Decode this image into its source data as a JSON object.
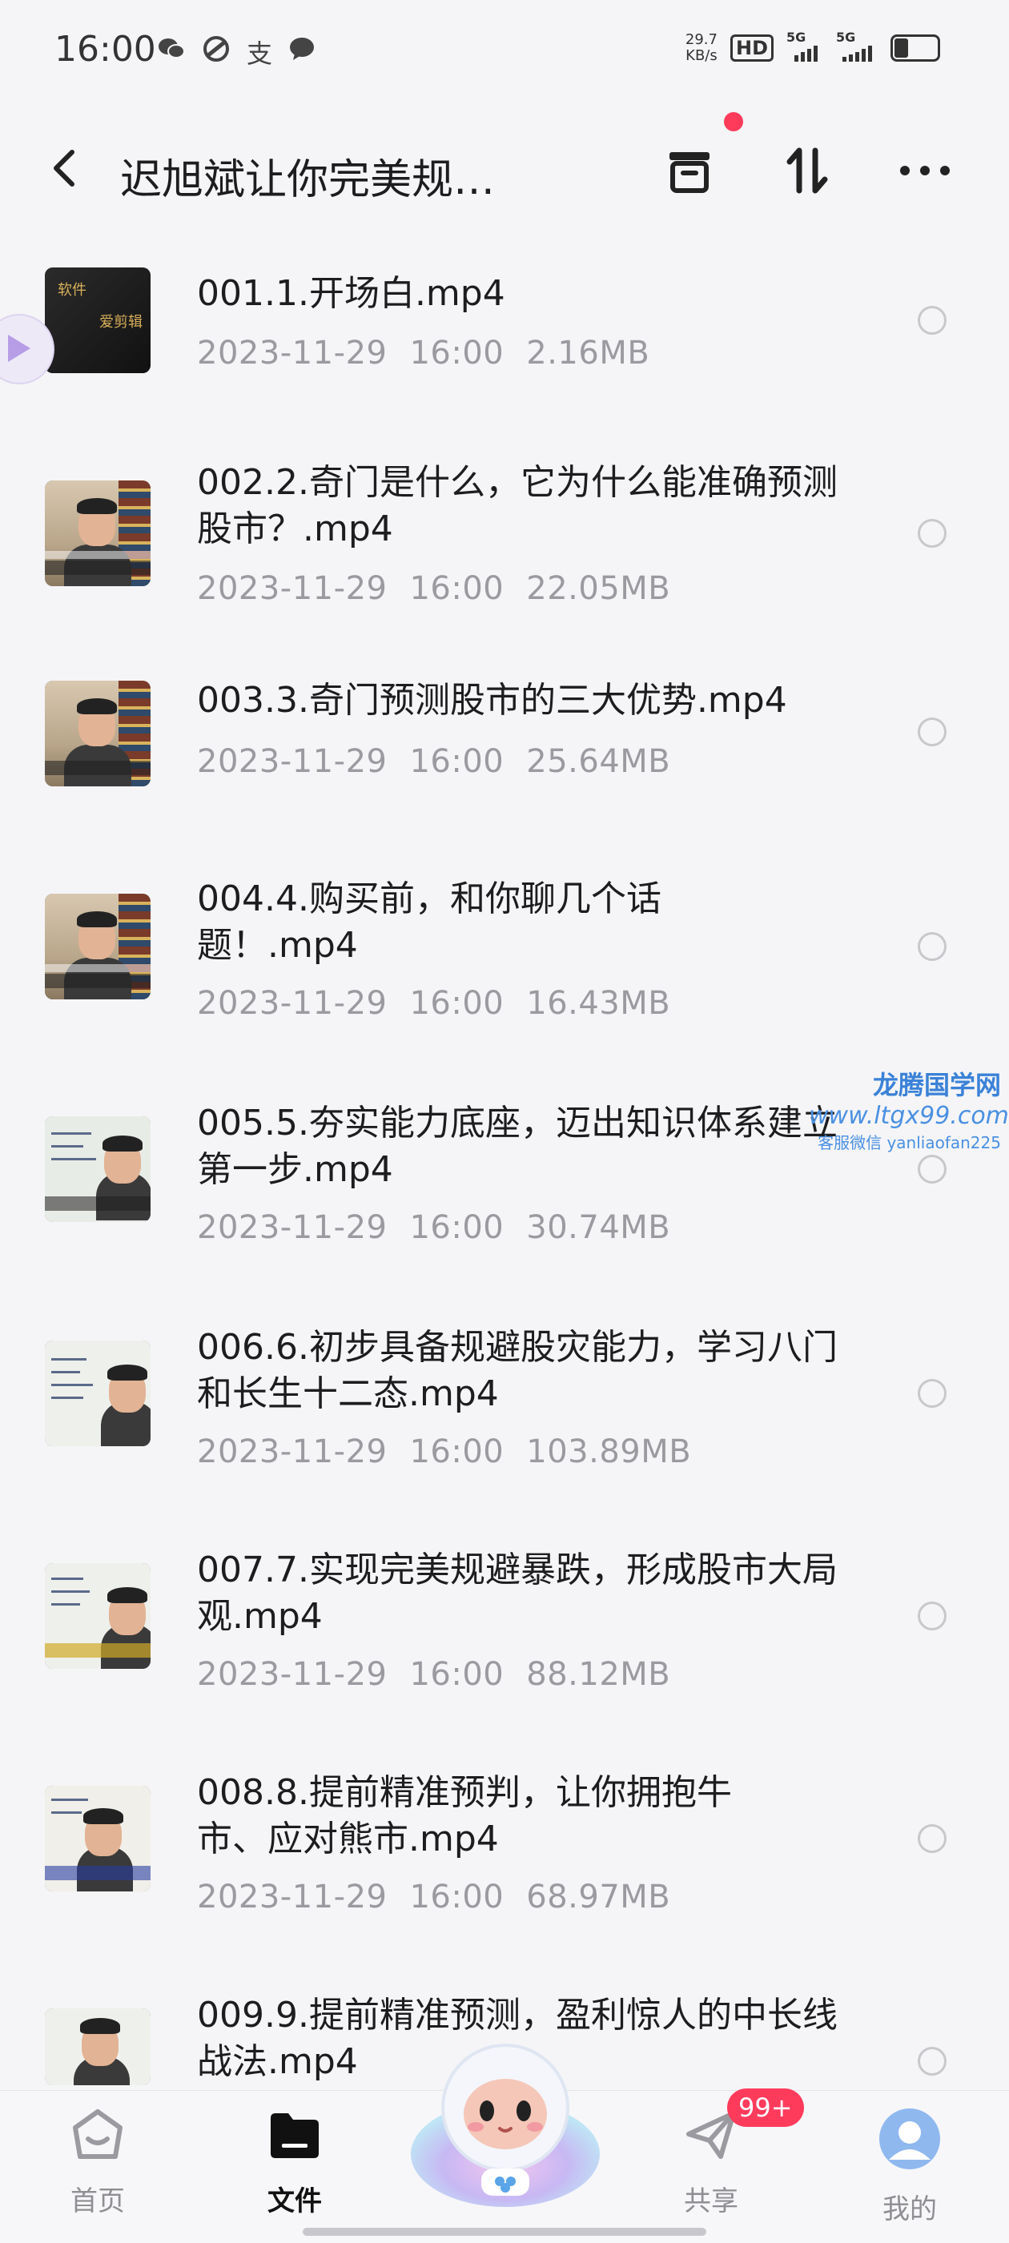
{
  "status_bar": {
    "time": "16:00",
    "notifications": [
      "wechat-icon",
      "link-icon",
      "支",
      "chat-icon"
    ],
    "net_speed": "29.7",
    "net_unit": "KB/s",
    "hd": "HD",
    "sim1": "5G",
    "sim2": "5G",
    "battery_level": 0.3
  },
  "header": {
    "title": "迟旭斌让你完美规…"
  },
  "files": [
    {
      "name": "001.1.开场白.mp4",
      "date": "2023-11-29",
      "time": "16:00",
      "size": "2.16MB",
      "thumb": "software"
    },
    {
      "name": "002.2.奇门是什么，它为什么能准确预测股市？.mp4",
      "date": "2023-11-29",
      "time": "16:00",
      "size": "22.05MB",
      "thumb": "speaker"
    },
    {
      "name": "003.3.奇门预测股市的三大优势.mp4",
      "date": "2023-11-29",
      "time": "16:00",
      "size": "25.64MB",
      "thumb": "speaker"
    },
    {
      "name": "004.4.购买前，和你聊几个话题！.mp4",
      "date": "2023-11-29",
      "time": "16:00",
      "size": "16.43MB",
      "thumb": "speaker"
    },
    {
      "name": "005.5.夯实能力底座，迈出知识体系建立第一步.mp4",
      "date": "2023-11-29",
      "time": "16:00",
      "size": "30.74MB",
      "thumb": "board"
    },
    {
      "name": "006.6.初步具备规避股灾能力，学习八门和长生十二态.mp4",
      "date": "2023-11-29",
      "time": "16:00",
      "size": "103.89MB",
      "thumb": "board"
    },
    {
      "name": "007.7.实现完美规避暴跌，形成股市大局观.mp4",
      "date": "2023-11-29",
      "time": "16:00",
      "size": "88.12MB",
      "thumb": "board"
    },
    {
      "name": "008.8.提前精准预判，让你拥抱牛市、应对熊市.mp4",
      "date": "2023-11-29",
      "time": "16:00",
      "size": "68.97MB",
      "thumb": "board"
    },
    {
      "name": "009.9.提前精准预测，盈利惊人的中长线战法.mp4",
      "date": "",
      "time": "",
      "size": "",
      "thumb": "board"
    }
  ],
  "thumb_text": {
    "tag1": "软件",
    "tag2": "爱剪辑"
  },
  "watermark": {
    "line1": "龙腾国学网",
    "line2": "www.ltgx99.com",
    "line3": "客服微信 yanliaofan225"
  },
  "bottom_nav": {
    "home": "首页",
    "files": "文件",
    "share": "共享",
    "me": "我的",
    "share_badge": "99+"
  }
}
